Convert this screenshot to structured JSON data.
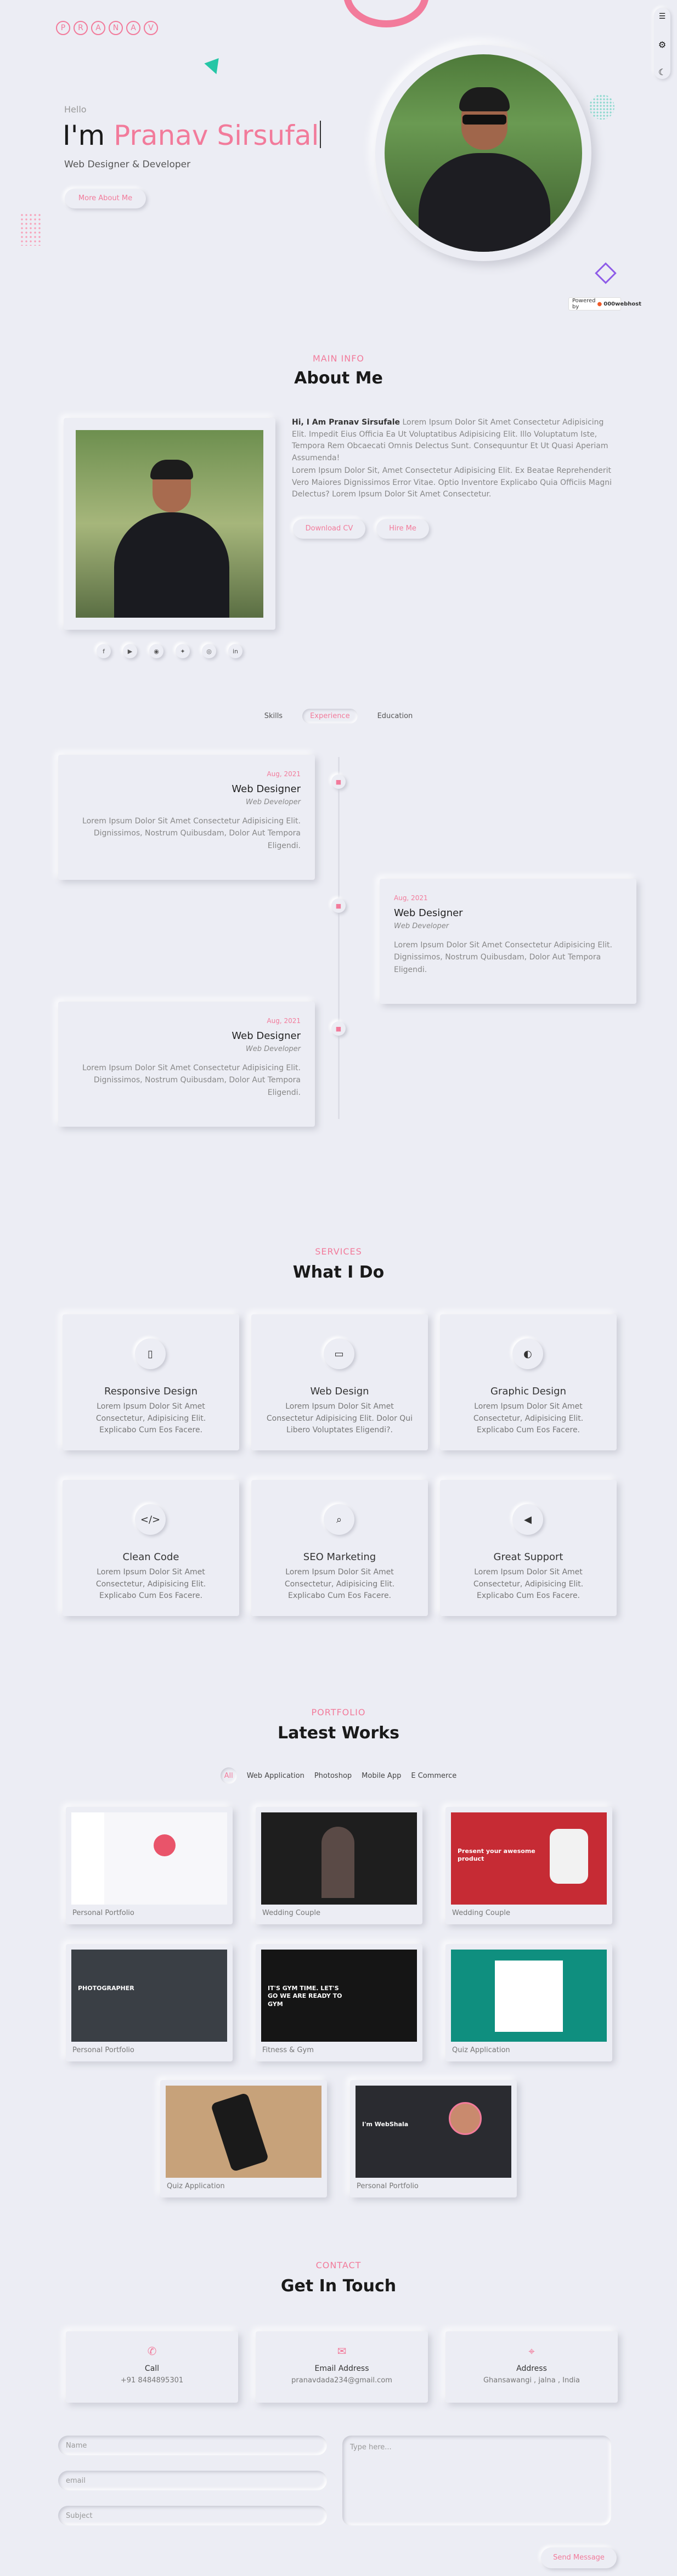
{
  "brand": {
    "logo_letters": [
      "P",
      "R",
      "A",
      "N",
      "A",
      "V"
    ]
  },
  "hero": {
    "greeting": "Hello",
    "prefix": "I'm ",
    "name": "Pranav Sirsufal",
    "role": "Web Designer & Developer",
    "cta": "More About Me",
    "badge_prefix": "Powered by",
    "badge_brand": "000webhost"
  },
  "about": {
    "sub": "MAIN INFO",
    "title": "About Me",
    "intro_bold": "Hi, I Am Pranav Sirsufale",
    "intro_rest": " Lorem Ipsum Dolor Sit Amet Consectetur Adipisicing Elit. Impedit Eius Officia Ea Ut Voluptatibus Adipisicing Elit. Illo Voluptatum Iste, Tempora Rem Obcaecati Omnis Delectus Sunt. Consequuntur Et Ut Quasi Aperiam Assumenda!",
    "para2": "Lorem Ipsum Dolor Sit, Amet Consectetur Adipisicing Elit. Ex Beatae Reprehenderit Vero Maiores Dignissimos Error Vitae. Optio Inventore Explicabo Quia Officiis Magni Delectus? Lorem Ipsum Dolor Sit Amet Consectetur.",
    "btn_cv": "Download CV",
    "btn_hire": "Hire Me",
    "social_icons": [
      "facebook-icon",
      "youtube-icon",
      "github-icon",
      "twitter-icon",
      "instagram-icon",
      "linkedin-icon"
    ]
  },
  "tabs": {
    "items": [
      "Skills",
      "Experience",
      "Education"
    ],
    "active": "Experience"
  },
  "timeline": [
    {
      "date": "Aug, 2021",
      "title": "Web Designer",
      "role": "Web Developer",
      "text": "Lorem Ipsum Dolor Sit Amet Consectetur Adipisicing Elit. Dignissimos, Nostrum Quibusdam, Dolor Aut Tempora Eligendi."
    },
    {
      "date": "Aug, 2021",
      "title": "Web Designer",
      "role": "Web Developer",
      "text": "Lorem Ipsum Dolor Sit Amet Consectetur Adipisicing Elit. Dignissimos, Nostrum Quibusdam, Dolor Aut Tempora Eligendi."
    },
    {
      "date": "Aug, 2021",
      "title": "Web Designer",
      "role": "Web Developer",
      "text": "Lorem Ipsum Dolor Sit Amet Consectetur Adipisicing Elit. Dignissimos, Nostrum Quibusdam, Dolor Aut Tempora Eligendi."
    }
  ],
  "services": {
    "sub": "SERVICES",
    "title": "What I Do",
    "items": [
      {
        "icon": "mobile-icon",
        "title": "Responsive Design",
        "text": "Lorem Ipsum Dolor Sit Amet Consectetur, Adipisicing Elit. Explicabo Cum Eos Facere."
      },
      {
        "icon": "laptop-icon",
        "title": "Web Design",
        "text": "Lorem Ipsum Dolor Sit Amet Consectetur Adipisicing Elit. Dolor Qui Libero Voluptates Eligendi?."
      },
      {
        "icon": "palette-icon",
        "title": "Graphic Design",
        "text": "Lorem Ipsum Dolor Sit Amet Consectetur, Adipisicing Elit. Explicabo Cum Eos Facere."
      },
      {
        "icon": "code-icon",
        "title": "Clean Code",
        "text": "Lorem Ipsum Dolor Sit Amet Consectetur, Adipisicing Elit. Explicabo Cum Eos Facere."
      },
      {
        "icon": "search-icon",
        "title": "SEO Marketing",
        "text": "Lorem Ipsum Dolor Sit Amet Consectetur, Adipisicing Elit. Explicabo Cum Eos Facere."
      },
      {
        "icon": "megaphone-icon",
        "title": "Great Support",
        "text": "Lorem Ipsum Dolor Sit Amet Consectetur, Adipisicing Elit. Explicabo Cum Eos Facere."
      }
    ]
  },
  "portfolio": {
    "sub": "PORTFOLIO",
    "title": "Latest Works",
    "filters": [
      "All",
      "Web Application",
      "Photoshop",
      "Mobile App",
      "E Commerce"
    ],
    "active": "All",
    "items": [
      {
        "label": "Personal Portfolio",
        "theme": "light"
      },
      {
        "label": "Wedding Couple",
        "theme": "dark"
      },
      {
        "label": "Wedding Couple",
        "theme": "red",
        "shot_title": "Present your awesome product"
      },
      {
        "label": "Personal Portfolio",
        "theme": "photo",
        "shot_title": "PHOTOGRAPHER"
      },
      {
        "label": "Fitness & Gym",
        "theme": "gym",
        "shot_title": "IT'S GYM TIME. LET'S GO WE ARE READY TO GYM"
      },
      {
        "label": "Quiz Application",
        "theme": "quiz"
      },
      {
        "label": "Quiz Application",
        "theme": "phone"
      },
      {
        "label": "Personal Portfolio",
        "theme": "webdev",
        "shot_title": "I'm WebShala"
      }
    ]
  },
  "contact": {
    "sub": "CONTACT",
    "title": "Get In Touch",
    "cards": [
      {
        "icon": "phone-icon",
        "title": "Call",
        "value": "+91 8484895301"
      },
      {
        "icon": "email-icon",
        "title": "Email Address",
        "value": "pranavdada234@gmail.com"
      },
      {
        "icon": "location-icon",
        "title": "Address",
        "value": "Ghansawangi , jalna , India"
      }
    ],
    "placeholders": {
      "name": "Name",
      "email": "email",
      "subject": "Subject",
      "message": "Type here..."
    },
    "send": "Send Message"
  },
  "colors": {
    "accent": "#f27b9b",
    "background": "#ecedf4"
  }
}
